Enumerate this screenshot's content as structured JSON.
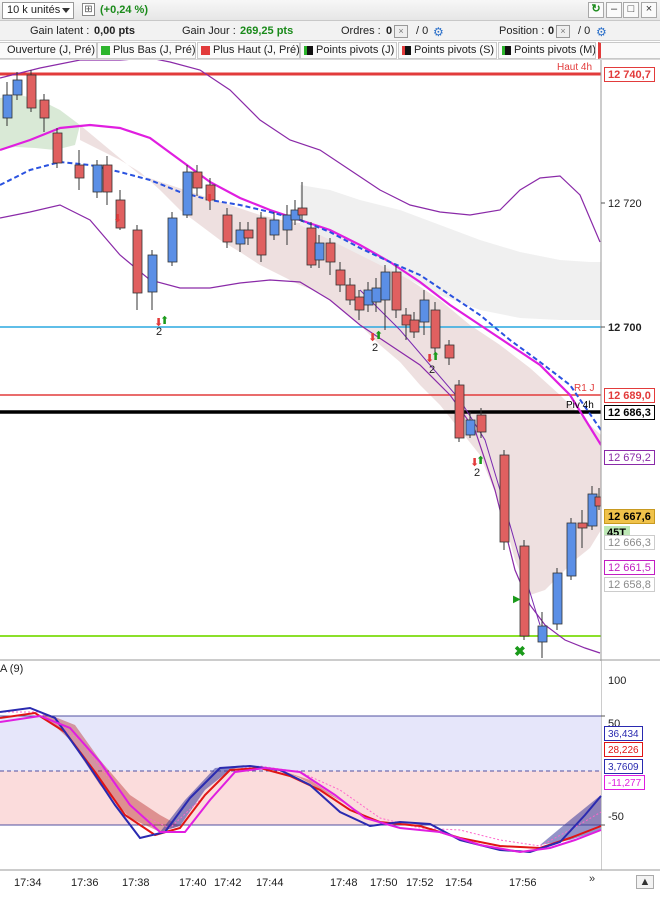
{
  "toolbar": {
    "quantity": "10 k unités",
    "percent_change": "(+0,24 %)",
    "pct_toggle_glyph": "⊞"
  },
  "infobar": {
    "latent_label": "Gain latent :",
    "latent_value": "0,00 pts",
    "day_label": "Gain Jour :",
    "day_value": "269,25 pts",
    "orders_label": "Ordres :",
    "orders_value": "0",
    "orders_sep": "/ 0",
    "position_label": "Position :",
    "position_value": "0",
    "position_sep": "/ 0"
  },
  "legend": [
    {
      "label": "Ouverture (J, Pré)",
      "color": "#ffffff"
    },
    {
      "label": "Plus Bas (J, Pré)",
      "color": "#2db52d"
    },
    {
      "label": "Plus Haut (J, Pré)",
      "color": "#e23b3b"
    },
    {
      "label": "Points pivots (J)",
      "color": "#111111"
    },
    {
      "label": "Points pivots (S)",
      "color": "#111111"
    },
    {
      "label": "Points pivots (M)",
      "color": "#111111"
    }
  ],
  "price_axis": {
    "tick_12720": "12 720",
    "tick_12700": "12 700",
    "tick_100": "100",
    "tick_50": "50",
    "tick_m50": "-50"
  },
  "price_tags": {
    "haut_4h": "12 740,7",
    "r1": "12 689,0",
    "piv_4h": "12 686,3",
    "purple": "12 679,2",
    "last": "12 667,6",
    "timer": "45T",
    "gray1": "12 666,3",
    "magenta": "12 661,5",
    "gray2": "12 658,8"
  },
  "line_labels": {
    "haut_4h": "Haut 4h",
    "r1": "R1 J",
    "piv_4h": "Piv 4h"
  },
  "indicator": {
    "name": "A (9)",
    "v1": "36,434",
    "v2": "28,226",
    "v3": "3,7609",
    "v4": "-11,277"
  },
  "signal_counts": {
    "s1": "2",
    "s2": "2",
    "s3": "2",
    "s4": "2"
  },
  "time_axis": [
    "17:34",
    "17:36",
    "17:38",
    "17:40",
    "17:42",
    "17:44",
    "17:48",
    "17:50",
    "17:52",
    "17:54",
    "17:56"
  ],
  "buttons": {
    "scroll_right": "»",
    "scroll_end": "▲"
  },
  "colors": {
    "up": "#5b8fe6",
    "down": "#e06060",
    "haut": "#e23b3b",
    "pivot": "#000000",
    "blue_line": "#2aa8e0",
    "green_line": "#8be02a"
  }
}
